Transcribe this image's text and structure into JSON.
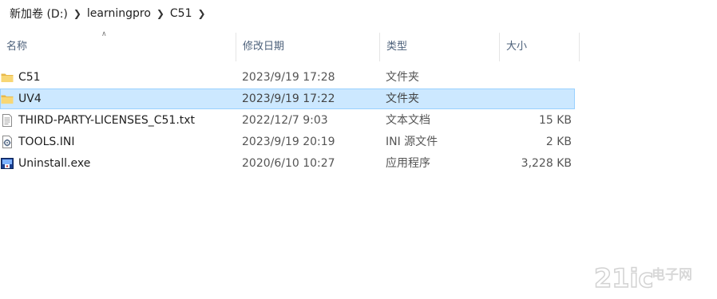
{
  "breadcrumb": {
    "items": [
      "新加卷 (D:)",
      "learningpro",
      "C51"
    ]
  },
  "columns": {
    "name": "名称",
    "date": "修改日期",
    "type": "类型",
    "size": "大小"
  },
  "files": [
    {
      "name": "C51",
      "date": "2023/9/19 17:28",
      "type": "文件夹",
      "size": "",
      "icon": "folder-icon",
      "selected": false
    },
    {
      "name": "UV4",
      "date": "2023/9/19 17:22",
      "type": "文件夹",
      "size": "",
      "icon": "folder-icon",
      "selected": true
    },
    {
      "name": "THIRD-PARTY-LICENSES_C51.txt",
      "date": "2022/12/7 9:03",
      "type": "文本文档",
      "size": "15 KB",
      "icon": "text-file-icon",
      "selected": false
    },
    {
      "name": "TOOLS.INI",
      "date": "2023/9/19 20:19",
      "type": "INI 源文件",
      "size": "2 KB",
      "icon": "ini-file-icon",
      "selected": false
    },
    {
      "name": "Uninstall.exe",
      "date": "2020/6/10 10:27",
      "type": "应用程序",
      "size": "3,228 KB",
      "icon": "exe-file-icon",
      "selected": false
    }
  ],
  "watermark": {
    "text_main": "21ic",
    "text_sub": "电子网"
  },
  "colors": {
    "selection_bg": "#cce8ff",
    "selection_border": "#99d1ff",
    "folder": "#f8d775",
    "header_text": "#4c607a"
  }
}
